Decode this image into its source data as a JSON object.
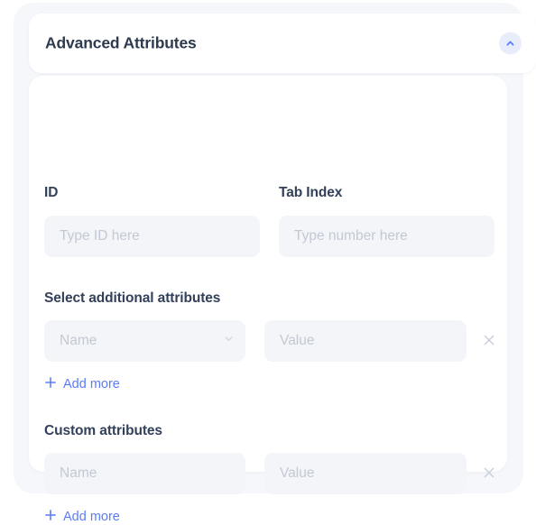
{
  "panel": {
    "title": "Advanced Attributes",
    "collapse_icon": "chevron-up-icon",
    "expanded": true
  },
  "fields": {
    "id": {
      "label": "ID",
      "placeholder": "Type ID here",
      "value": ""
    },
    "tab_index": {
      "label": "Tab Index",
      "placeholder": "Type number here",
      "value": ""
    }
  },
  "select_attributes": {
    "section_label": "Select additional attributes",
    "rows": [
      {
        "name_placeholder": "Name",
        "name_value": "",
        "value_placeholder": "Value",
        "value_value": "",
        "dropdown_icon": "chevron-down-icon",
        "remove_icon": "close-icon"
      }
    ],
    "add_more_label": "Add more",
    "add_more_icon": "plus-icon"
  },
  "custom_attributes": {
    "section_label": "Custom attributes",
    "rows": [
      {
        "name_placeholder": "Name",
        "name_value": "",
        "value_placeholder": "Value",
        "value_value": "",
        "remove_icon": "close-icon"
      }
    ],
    "add_more_label": "Add more",
    "add_more_icon": "plus-icon"
  },
  "colors": {
    "page_background": "#ffffff",
    "shell_background": "#f5f7fb",
    "card_background": "#ffffff",
    "input_background": "#f3f5f9",
    "label_text": "#32405a",
    "placeholder_text": "#c3c9d4",
    "accent_link": "#5b7cfa",
    "collapse_button_background": "#e8edfc",
    "remove_icon": "#c9cfdd"
  }
}
